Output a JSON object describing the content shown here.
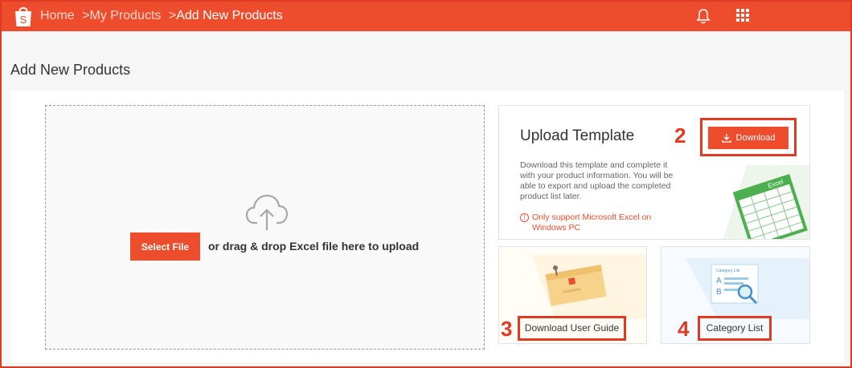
{
  "header": {
    "breadcrumb": [
      "Home",
      "My Products",
      "Add New Products"
    ],
    "separator": ">"
  },
  "page_title": "Add New Products",
  "upload": {
    "select_button": "Select File",
    "drop_text": "or drag & drop Excel file here to upload"
  },
  "template": {
    "title": "Upload Template",
    "download_button": "Download",
    "description": "Download this template and complete it with your product information. You will be able to export and upload the completed product list later.",
    "warning": "Only support Microsoft Excel on Windows PC",
    "excel_label": "Excel",
    "marker": "2"
  },
  "guide": {
    "label": "Download User Guide",
    "marker": "3"
  },
  "category": {
    "label": "Category List",
    "art_text": "Category List",
    "marker": "4"
  },
  "colors": {
    "brand": "#ee4d2d",
    "annotation": "#e03a22"
  }
}
